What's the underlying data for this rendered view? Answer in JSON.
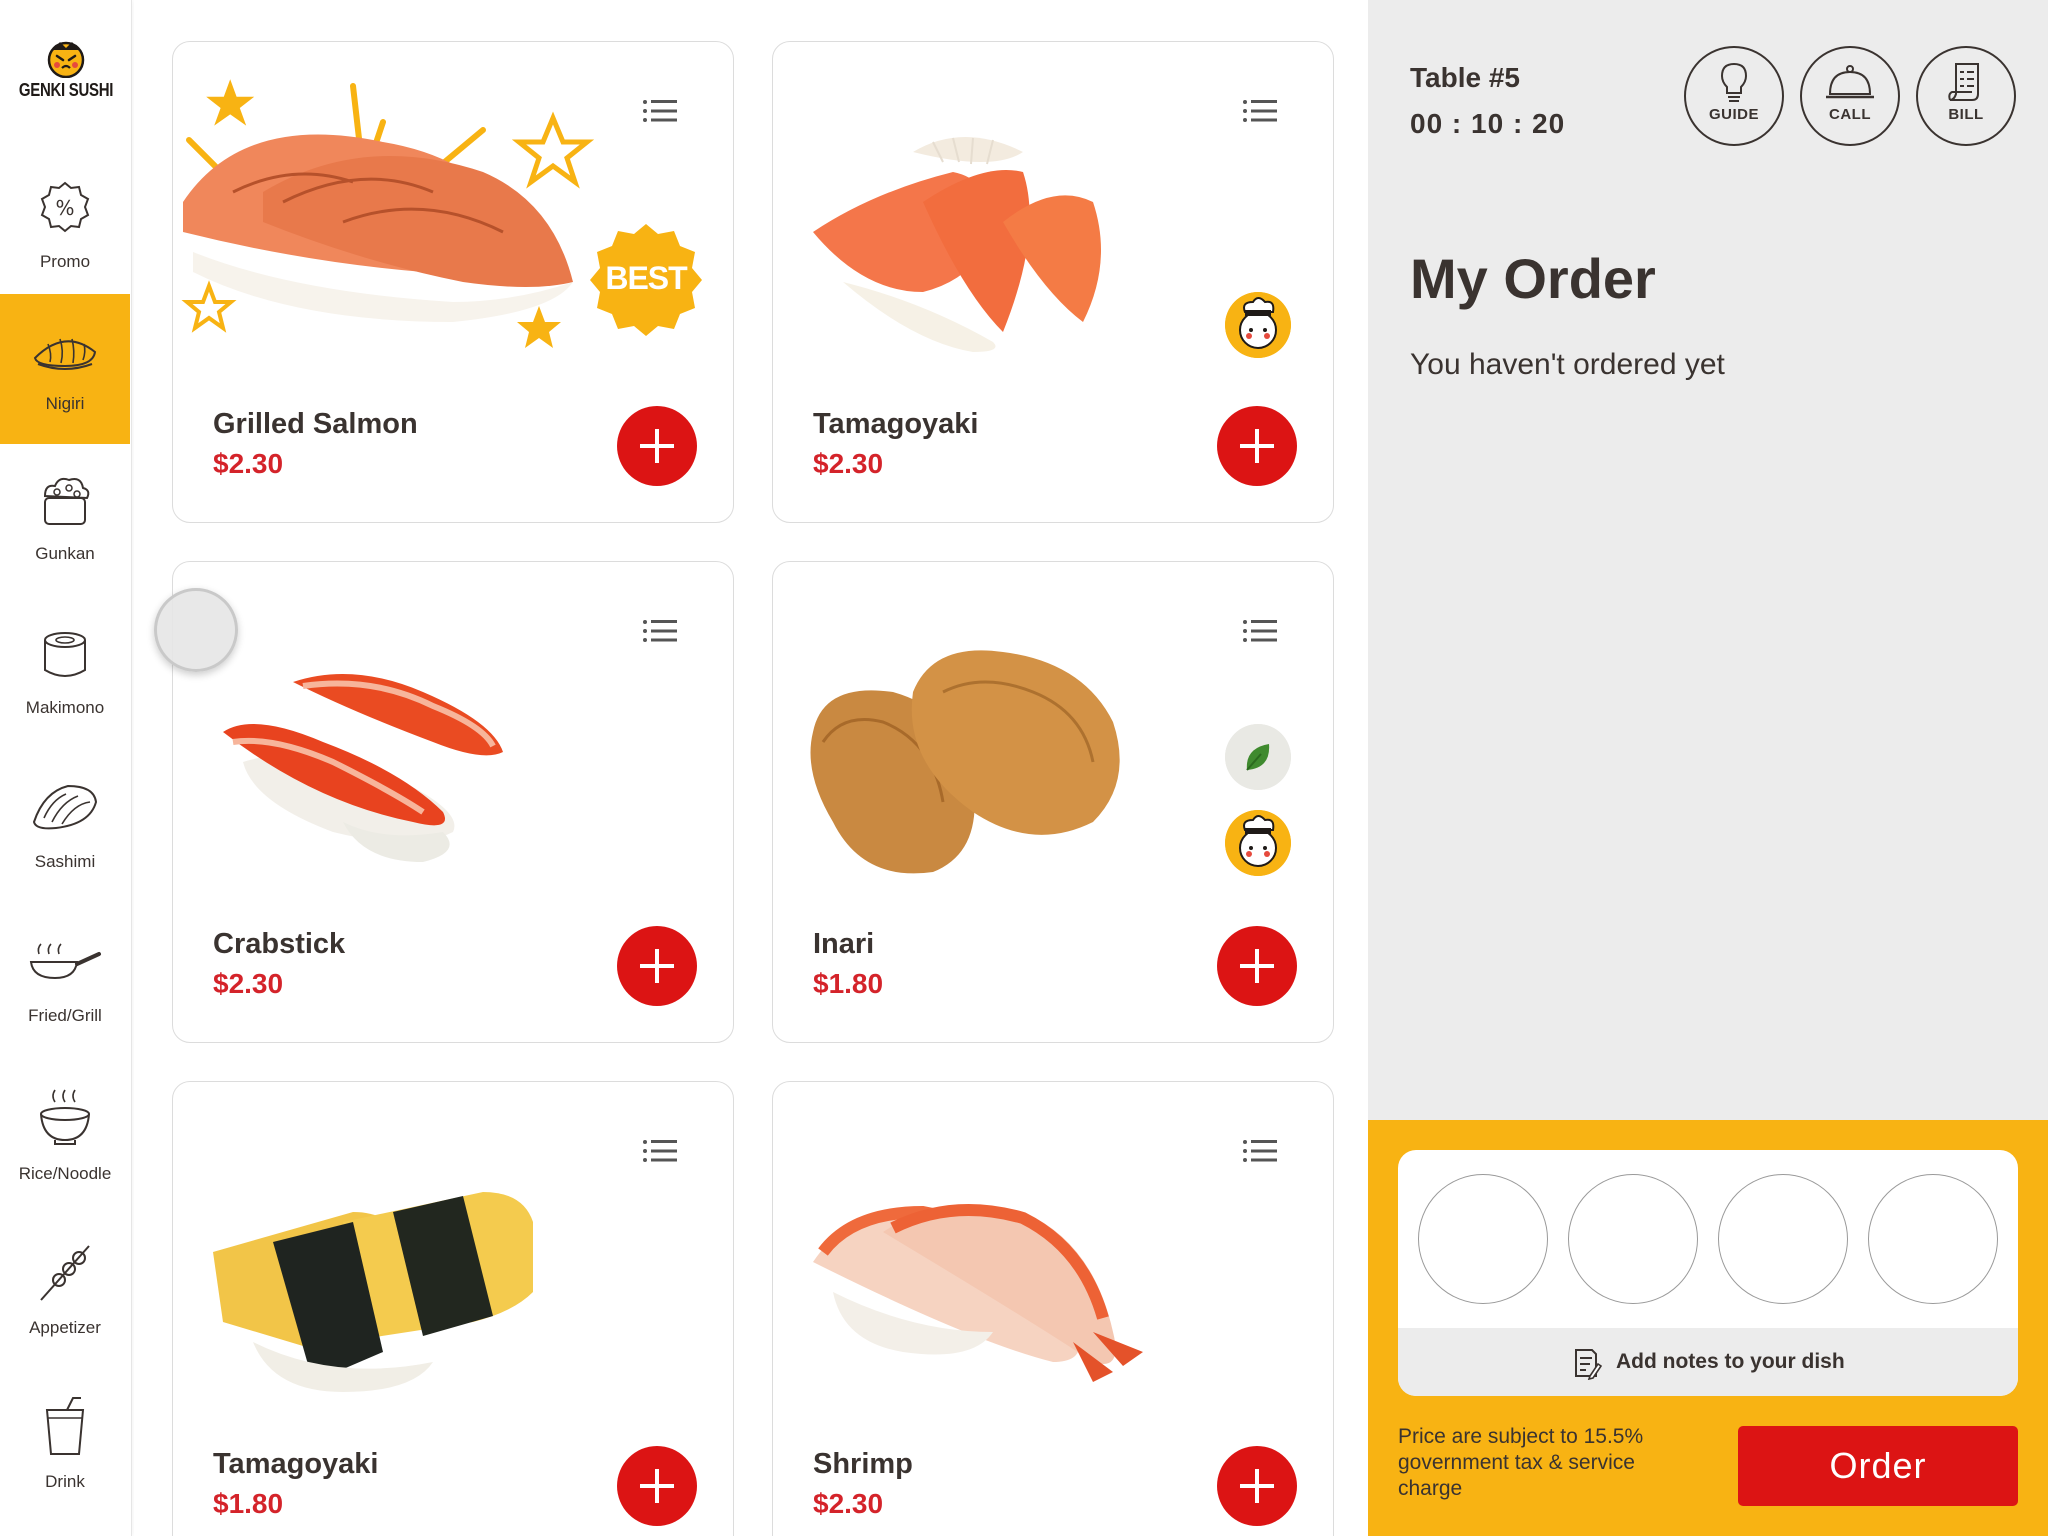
{
  "brand": {
    "name": "GENKI SUSHI",
    "accent": "#f8b313",
    "red": "#dc1414"
  },
  "sidebar": {
    "items": [
      {
        "label": "Promo",
        "icon": "percent-badge-icon"
      },
      {
        "label": "Nigiri",
        "icon": "nigiri-icon",
        "active": true
      },
      {
        "label": "Gunkan",
        "icon": "gunkan-icon"
      },
      {
        "label": "Makimono",
        "icon": "makimono-icon"
      },
      {
        "label": "Sashimi",
        "icon": "sashimi-icon"
      },
      {
        "label": "Fried/Grill",
        "icon": "frying-pan-icon"
      },
      {
        "label": "Rice/Noodle",
        "icon": "rice-bowl-icon"
      },
      {
        "label": "Appetizer",
        "icon": "skewer-icon"
      },
      {
        "label": "Drink",
        "icon": "drink-cup-icon"
      }
    ]
  },
  "menu": {
    "items": [
      {
        "name": "Grilled Salmon",
        "price": "$2.30",
        "badge": "BEST"
      },
      {
        "name": "Tamagoyaki",
        "price": "$2.30",
        "chef": true
      },
      {
        "name": "Crabstick",
        "price": "$2.30"
      },
      {
        "name": "Inari",
        "price": "$1.80",
        "veg": true,
        "chef": true
      },
      {
        "name": "Tamagoyaki",
        "price": "$1.80"
      },
      {
        "name": "Shrimp",
        "price": "$2.30"
      }
    ]
  },
  "panel": {
    "table": "Table #5",
    "timer": "00 : 10 : 20",
    "buttons": {
      "guide": "GUIDE",
      "call": "CALL",
      "bill": "BILL"
    },
    "title": "My Order",
    "empty_message": "You haven't ordered yet",
    "notes_label": "Add notes to your dish",
    "disclaimer": "Price are subject to 15.5% government tax & service charge",
    "order_label": "Order"
  }
}
